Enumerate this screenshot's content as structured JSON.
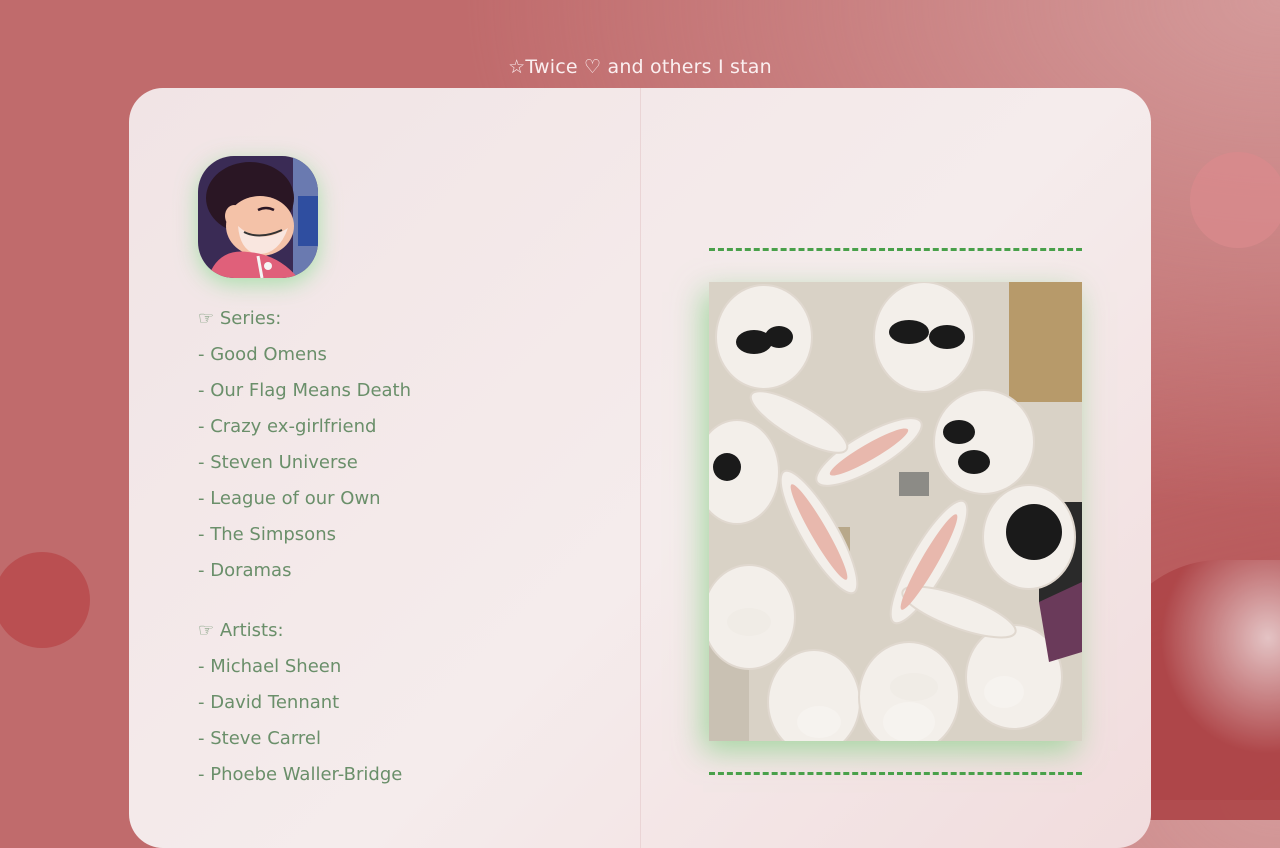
{
  "header": {
    "title": "☆Twice ♡ and others I stan"
  },
  "profile": {
    "avatar_icon": "steven-universe-avatar"
  },
  "series": {
    "heading": "☞ Series:",
    "items": [
      "- Good Omens",
      "- Our Flag Means Death",
      "- Crazy ex-girlfriend",
      "- Steven Universe",
      "- League of our Own",
      "- The Simpsons",
      "- Doramas"
    ]
  },
  "artists": {
    "heading": "☞ Artists:",
    "items": [
      "- Michael Sheen",
      "- David Tennant",
      "- Steve Carrel",
      "- Phoebe Waller-Bridge"
    ]
  },
  "colors": {
    "background": "#c06b6c",
    "card": "#f3e8e8",
    "text": "#6a8f6a",
    "accent_dash": "#49a04a"
  }
}
